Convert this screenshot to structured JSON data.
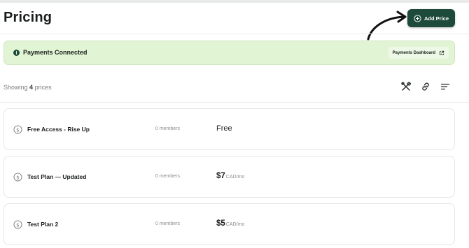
{
  "header": {
    "title": "Pricing",
    "add_price_label": "Add Price"
  },
  "banner": {
    "status": "Payments Connected",
    "dashboard_label": "Payments Dashboard"
  },
  "list_summary": {
    "prefix": "Showing",
    "count": "4",
    "suffix": "prices"
  },
  "prices": [
    {
      "name": "Free Access - Rise Up",
      "members": "0 members",
      "price": "Free",
      "unit": ""
    },
    {
      "name": "Test Plan — Updated",
      "members": "0 members",
      "price": "$7",
      "unit": "CAD/mo"
    },
    {
      "name": "Test Plan 2",
      "members": "0 members",
      "price": "$5",
      "unit": "CAD/mo"
    }
  ],
  "colors": {
    "primary": "#1e4a3b",
    "banner_bg": "#e1f4d4",
    "muted_text": "#8a8e8b"
  },
  "icons": {
    "add": "plus-circle-icon",
    "info": "info-icon",
    "external": "external-link-icon",
    "tool_1": "crossed-tools-icon",
    "tool_2": "link-icon",
    "tool_3": "sort-lines-icon",
    "price": "dollar-coin-icon"
  }
}
